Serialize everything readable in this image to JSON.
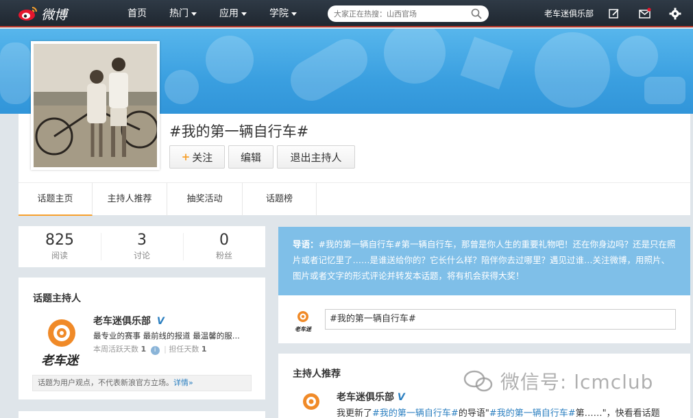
{
  "nav": {
    "logo_text": "微博",
    "links": [
      {
        "label": "首页",
        "has_caret": false
      },
      {
        "label": "热门",
        "has_caret": true
      },
      {
        "label": "应用",
        "has_caret": true
      },
      {
        "label": "学院",
        "has_caret": true
      }
    ],
    "search_placeholder": "大家正在热搜：山西官场",
    "username": "老车迷俱乐部",
    "icons": [
      "edit-icon",
      "message-icon",
      "settings-icon"
    ]
  },
  "topic": {
    "title": "#我的第一辆自行车#",
    "follow_label": "关注",
    "edit_label": "编辑",
    "quit_label": "退出主持人"
  },
  "tabs": [
    "话题主页",
    "主持人推荐",
    "抽奖活动",
    "话题榜"
  ],
  "stats": [
    {
      "num": "825",
      "label": "阅读"
    },
    {
      "num": "3",
      "label": "讨论"
    },
    {
      "num": "0",
      "label": "粉丝"
    }
  ],
  "host": {
    "heading": "话题主持人",
    "name": "老车迷俱乐部",
    "desc": "最专业的赛事 最前线的报道 最温馨的服...",
    "active_label": "本周活跃天数",
    "active_days": "1",
    "host_label": "担任天数",
    "host_days": "1",
    "logo_text": "老车迷"
  },
  "notice": {
    "text": "话题为用户观点，不代表新浪官方立场。",
    "link": "详情»"
  },
  "guide": {
    "label": "导语：",
    "text": "#我的第一辆自行车#第一辆自行车，那曾是你人生的重要礼物吧！还在你身边吗？还是只在照片或者记忆里了……是谁送给你的？它长什么样？陪伴你去过哪里？遇见过谁…关注微博，用照片、图片或者文字的形式评论并转发本话题，将有机会获得大奖！"
  },
  "composer": {
    "value": "#我的第一辆自行车#",
    "logo_text": "老车迷"
  },
  "recommend": {
    "heading": "主持人推荐",
    "name": "老车迷俱乐部",
    "text_prefix": "我更新了",
    "link1": "#我的第一辆自行车#",
    "text_mid1": "的导语\"",
    "link2": "#我的第一辆自行车#",
    "text_mid2": "第……\"，快看看话题"
  },
  "watermark": "微信号: lcmclub",
  "colors": {
    "accent": "#f7a02c",
    "link": "#2b7fc0",
    "nav_bg": "#2a3440",
    "cover_blue": "#3a9fe0",
    "guide_bg": "#7fbfe8"
  }
}
